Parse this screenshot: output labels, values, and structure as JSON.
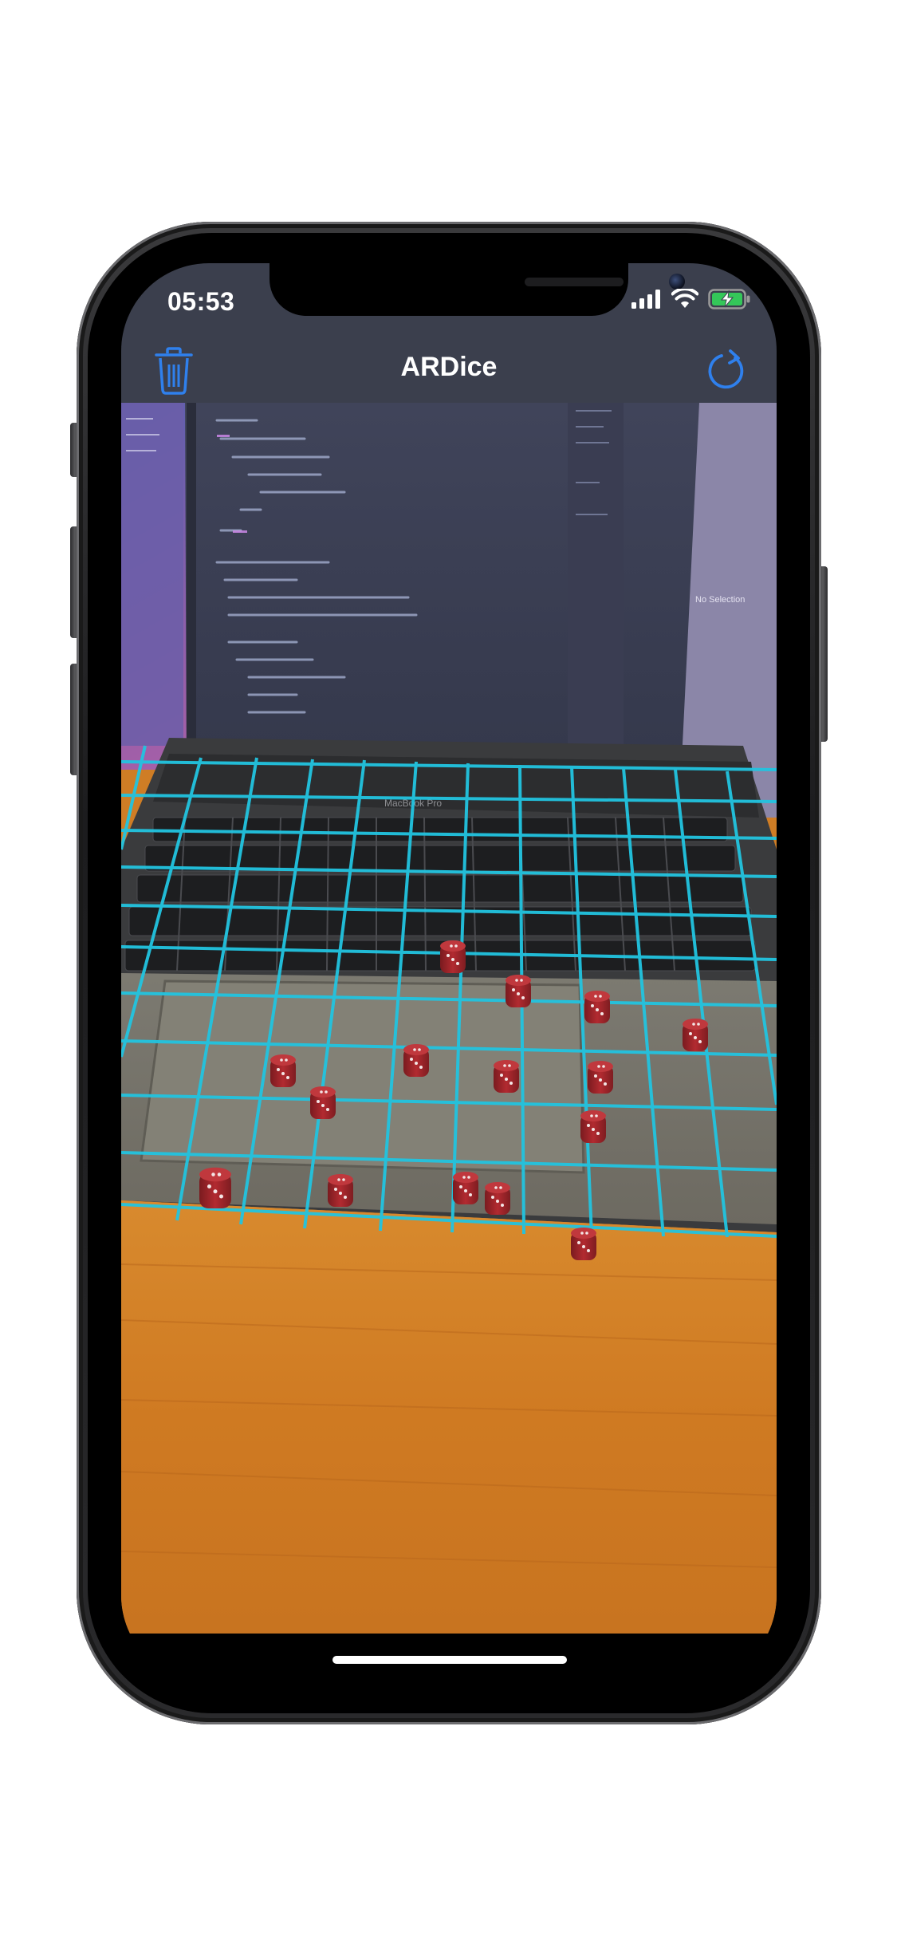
{
  "status_bar": {
    "time": "05:53",
    "signal_icon": "cellular-signal-icon",
    "wifi_icon": "wifi-icon",
    "battery_icon": "battery-charging-icon"
  },
  "nav_bar": {
    "title": "ARDice",
    "left_button_icon": "trash-icon",
    "right_button_icon": "reload-icon"
  },
  "scene": {
    "background_label": "No Selection",
    "laptop_label": "MacBook Pro"
  },
  "colors": {
    "accent": "#2f80ed",
    "plane_grid": "#22c4e0",
    "dice": "#a5262a",
    "nav_background": "#3b3f4d"
  }
}
